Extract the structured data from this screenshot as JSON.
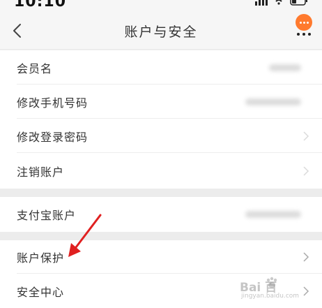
{
  "status_bar": {
    "time": "10:10"
  },
  "header": {
    "title": "账户与安全",
    "back_icon": "chevron-left-icon",
    "more_icon": "more-icon",
    "accent_color": "#ff7a2e"
  },
  "rows": [
    {
      "label": "会员名"
    },
    {
      "label": "修改手机号码"
    },
    {
      "label": "修改登录密码"
    },
    {
      "label": "注销账户"
    },
    {
      "label": "支付宝账户"
    },
    {
      "label": "账户保护"
    },
    {
      "label": "安全中心"
    }
  ],
  "annotation": {
    "arrow_color": "#e02020"
  },
  "watermark": {
    "brand": "Bai  百",
    "sub": "jingyan.baidu.com"
  }
}
